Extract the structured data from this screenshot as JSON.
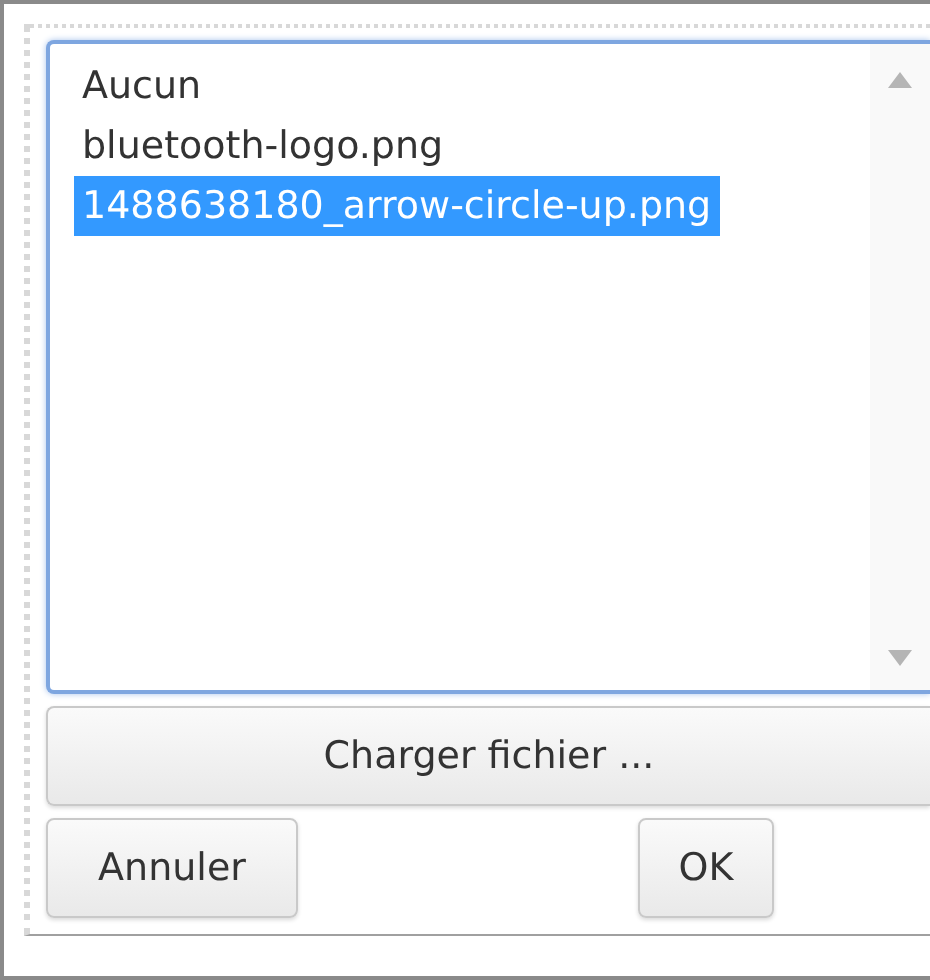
{
  "file_list": {
    "items": [
      {
        "label": "Aucun",
        "selected": false
      },
      {
        "label": "bluetooth-logo.png",
        "selected": false
      },
      {
        "label": "1488638180_arrow-circle-up.png",
        "selected": true
      }
    ]
  },
  "load_button": {
    "label": "Charger fichier ..."
  },
  "buttons": [
    {
      "label": "Annuler",
      "kind": "cancel"
    },
    {
      "label": "OK",
      "kind": "ok"
    }
  ]
}
